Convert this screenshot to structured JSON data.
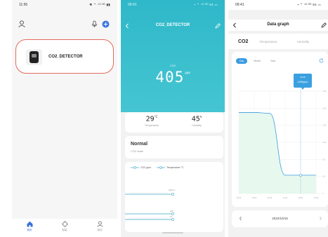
{
  "screen1": {
    "status": {
      "time": "11:56",
      "icons": "✱ ⌔ ⁴ᴳ ᴴᴰ ▮▮"
    },
    "device": {
      "name": "CO2_DETECTOR"
    },
    "tabbar": [
      {
        "label": "首页",
        "icon": "home-icon",
        "active": true
      },
      {
        "label": "智能",
        "icon": "smart-icon",
        "active": false
      },
      {
        "label": "我的",
        "icon": "profile-icon",
        "active": false
      }
    ]
  },
  "screen2": {
    "status": {
      "time": "09:41",
      "icons": "▪ ⌔ ⁴ᴳ ᴴᴰ 84 ▭"
    },
    "title": "CO2_DETECTOR",
    "co2_label": "CO2",
    "co2_value": "405",
    "co2_unit": "ppm",
    "temperature": {
      "value": "29",
      "unit": "°C",
      "label": "Temperature"
    },
    "humidity": {
      "value": "45",
      "unit": "%",
      "label": "Humidity"
    },
    "status_card": {
      "title": "Normal",
      "subtitle": "CO2 state"
    },
    "legend": [
      {
        "name": "CO2 ppm"
      },
      {
        "name": "Temperature °C"
      }
    ],
    "trend_labels": [
      "495ppm",
      "405",
      "29"
    ]
  },
  "screen3": {
    "status": {
      "time": "09:41",
      "icons": "▪ ⌔ ⁴ᴳ ᴴᴰ 84 ▭"
    },
    "title": "Data graph",
    "tabs": [
      "CO2",
      "Temperature",
      "Humidity"
    ],
    "range_tabs": [
      "Day",
      "Month",
      "Year"
    ],
    "tooltip": {
      "time": "09:38",
      "value": "1495ppm"
    },
    "date": "2022/10/18",
    "accent": "#3a9be0"
  },
  "chart_data": {
    "type": "area",
    "x": [
      "00:00",
      "06:00",
      "09:30",
      "12:00",
      "18:00",
      "24:00"
    ],
    "values": [
      1900,
      1900,
      1880,
      430,
      430,
      430
    ],
    "xlabel": "",
    "ylabel": "",
    "ylim": [
      0,
      2400
    ],
    "grid": true
  }
}
